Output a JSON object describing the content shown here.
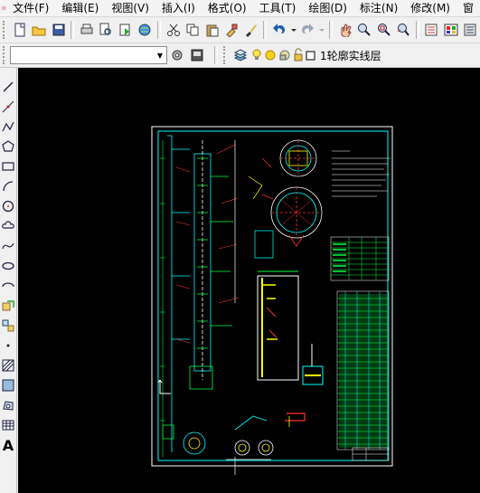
{
  "menu": [
    "文件(F)",
    "编辑(E)",
    "视图(V)",
    "插入(I)",
    "格式(O)",
    "工具(T)",
    "绘图(D)",
    "标注(N)",
    "修改(M)",
    "窗"
  ],
  "layer": {
    "current_name": "1轮廓实线层",
    "state_indicator": "1"
  },
  "command_letter": "A",
  "colors": {
    "accent_cyan": "#00ffff",
    "accent_green": "#00ff44",
    "drawing_yellow": "#ffff00",
    "drawing_red": "#ff3030",
    "canvas_bg": "#000000"
  },
  "icons": {
    "toolbar1": [
      "new-icon",
      "open-icon",
      "save-icon",
      "print-icon",
      "preview-icon",
      "publish-icon",
      "globe-icon",
      "cut-icon",
      "copy-icon",
      "paste-icon",
      "match-prop-icon",
      "brush-icon",
      "undo-icon",
      "redo-icon",
      "pan-realtime-icon",
      "zoom-realtime-icon",
      "zoom-window-icon",
      "zoom-previous-icon",
      "properties-icon",
      "design-center-icon",
      "tool-palette-icon"
    ],
    "left": [
      "line-icon",
      "construction-line-icon",
      "polyline-icon",
      "polygon-icon",
      "rectangle-icon",
      "arc-icon",
      "circle-icon",
      "revision-cloud-icon",
      "spline-icon",
      "ellipse-icon",
      "ellipse-arc-icon",
      "insert-block-icon",
      "make-block-icon",
      "point-icon",
      "hatch-icon",
      "gradient-icon",
      "region-icon",
      "table-icon",
      "mtext-icon"
    ]
  }
}
